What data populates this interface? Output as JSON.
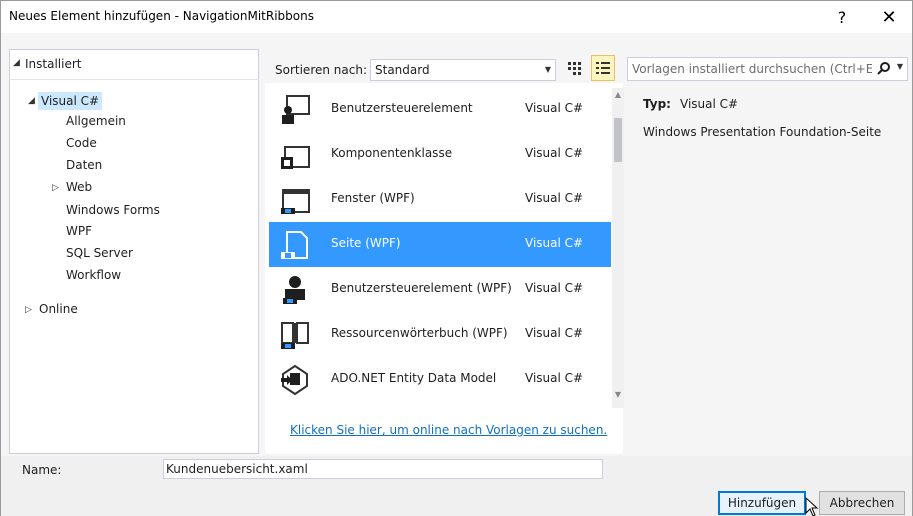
{
  "window": {
    "title": "Neues Element hinzufügen - NavigationMitRibbons",
    "help_label": "?",
    "close_label": "✕"
  },
  "left": {
    "header": "Installiert",
    "tree_root": "Visual C#",
    "children": [
      "Allgemein",
      "Code",
      "Daten",
      "Web",
      "Windows Forms",
      "WPF",
      "SQL Server",
      "Workflow"
    ],
    "online": "Online"
  },
  "toolbar": {
    "sort_label": "Sortieren nach:",
    "sort_value": "Standard"
  },
  "search": {
    "placeholder": "Vorlagen installiert durchsuchen (Ctrl+E)"
  },
  "templates": [
    {
      "name": "Benutzersteuerelement",
      "lang": "Visual C#",
      "icon": "user-control-icon"
    },
    {
      "name": "Komponentenklasse",
      "lang": "Visual C#",
      "icon": "component-class-icon"
    },
    {
      "name": "Fenster (WPF)",
      "lang": "Visual C#",
      "icon": "wpf-window-icon"
    },
    {
      "name": "Seite (WPF)",
      "lang": "Visual C#",
      "icon": "wpf-page-icon"
    },
    {
      "name": "Benutzersteuerelement (WPF)",
      "lang": "Visual C#",
      "icon": "wpf-user-control-icon"
    },
    {
      "name": "Ressourcenwörterbuch (WPF)",
      "lang": "Visual C#",
      "icon": "resource-dictionary-icon"
    },
    {
      "name": "ADO.NET Entity Data Model",
      "lang": "Visual C#",
      "icon": "entity-data-model-icon"
    }
  ],
  "online_link": "Klicken Sie hier, um online nach Vorlagen zu suchen.",
  "details": {
    "type_label": "Typ:",
    "type_value": "Visual C#",
    "description": "Windows Presentation Foundation-Seite"
  },
  "bottom": {
    "name_label": "Name:",
    "name_value": "Kundenuebersicht.xaml",
    "add_button": "Hinzufügen",
    "cancel_button": "Abbrechen"
  },
  "colors": {
    "selection": "#3399ff",
    "tree_selection": "#cce8ff",
    "link": "#0e70c0"
  }
}
